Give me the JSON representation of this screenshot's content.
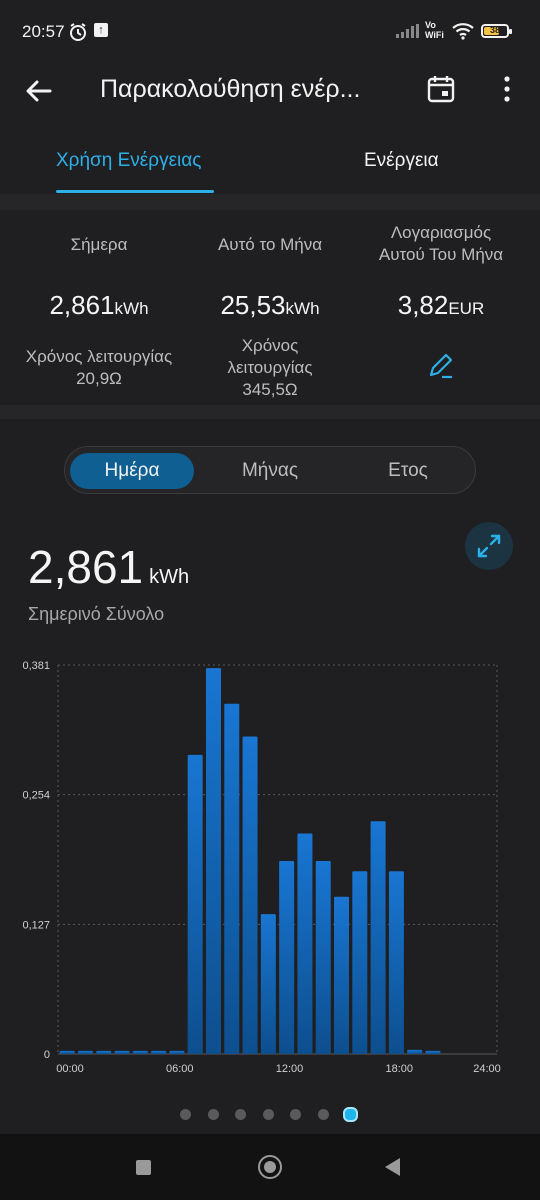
{
  "status_bar": {
    "time": "20:57",
    "network_label_top": "Vo",
    "network_label_bottom": "WiFi",
    "battery_level": "38"
  },
  "app_bar": {
    "title": "Παρακολούθηση ενέρ...",
    "icons": [
      "back-arrow-icon",
      "calendar-icon",
      "more-vert-icon"
    ]
  },
  "tabs": [
    {
      "label": "Χρήση Ενέργειας",
      "active": true
    },
    {
      "label": "Ενέργεια",
      "active": false
    }
  ],
  "stats": [
    {
      "label": "Σήμερα",
      "value": "2,861",
      "unit": "kWh",
      "sub": "Χρόνος λειτουργίας 20,9Ω"
    },
    {
      "label": "Αυτό το Μήνα",
      "value": "25,53",
      "unit": "kWh",
      "sub": "Χρόνος λειτουργίας 345,5Ω"
    },
    {
      "label": "Λογαριασμός Αυτού Του Μήνα",
      "value": "3,82",
      "unit": "EUR",
      "sub_icon": "edit-pencil-icon"
    }
  ],
  "period_selector": {
    "options": [
      "Ημέρα",
      "Μήνας",
      "Ετος"
    ],
    "selected": "Ημέρα"
  },
  "summary": {
    "total": "2,861",
    "unit": "kWh",
    "label": "Σημερινό Σύνολο"
  },
  "colors": {
    "accent": "#2bb0e8",
    "bar": "#1565c0",
    "segment_active": "#0f5f93"
  },
  "chart_data": {
    "type": "bar",
    "categories": [
      "00:00",
      "01:00",
      "02:00",
      "03:00",
      "04:00",
      "05:00",
      "06:00",
      "07:00",
      "08:00",
      "09:00",
      "10:00",
      "11:00",
      "12:00",
      "13:00",
      "14:00",
      "15:00",
      "16:00",
      "17:00",
      "18:00",
      "19:00",
      "20:00",
      "21:00",
      "22:00",
      "23:00"
    ],
    "values": [
      0.003,
      0.003,
      0.003,
      0.003,
      0.003,
      0.003,
      0.003,
      0.293,
      0.378,
      0.343,
      0.311,
      0.137,
      0.189,
      0.216,
      0.189,
      0.154,
      0.179,
      0.228,
      0.179,
      0.004,
      0.003,
      0,
      0,
      0
    ],
    "ylim": [
      0,
      0.381
    ],
    "yticks": [
      "0",
      "0,127",
      "0,254",
      "0,381"
    ],
    "xticks": [
      "00:00",
      "06:00",
      "12:00",
      "18:00",
      "24:00"
    ],
    "grid": true
  },
  "pager": {
    "count": 7,
    "active_index": 6
  }
}
